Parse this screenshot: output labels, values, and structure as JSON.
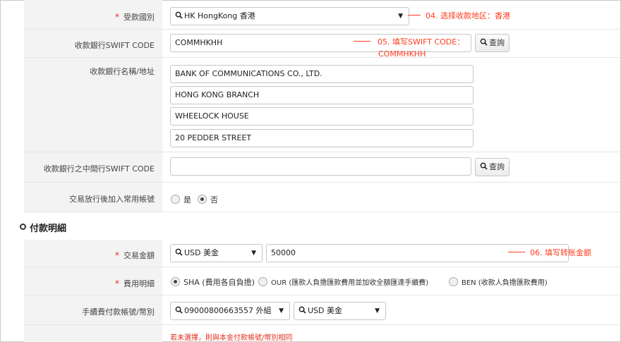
{
  "rows": {
    "country": {
      "label": "受款國別",
      "value": "HK HongKong 香港"
    },
    "swift": {
      "label": "收款銀行SWIFT CODE",
      "value": "COMMHKHH",
      "search_label": "查詢"
    },
    "bank_name": {
      "label": "收款銀行名稱/地址",
      "lines": [
        "BANK OF COMMUNICATIONS CO., LTD.",
        "HONG KONG BRANCH",
        "WHEELOCK HOUSE",
        "20 PEDDER STREET"
      ]
    },
    "intermediary": {
      "label": "收款銀行之中間行SWIFT CODE",
      "value": "",
      "search_label": "查詢"
    },
    "add_common": {
      "label": "交易放行後加入常用帳號",
      "options": [
        "是",
        "否"
      ],
      "selected": "否"
    }
  },
  "payment_section": {
    "title": "付款明細",
    "amount": {
      "label": "交易金額",
      "currency": "USD 美金",
      "value": "50000"
    },
    "fee": {
      "label": "費用明細",
      "options": [
        "SHA (費用各自負擔)",
        "OUR (匯款人負擔匯款費用並加收全額匯達手續費)",
        "BEN (收款人負擔匯款費用)"
      ],
      "selected": "SHA (費用各自負擔)"
    },
    "fee_account": {
      "label": "手續費付款帳號/幣別",
      "account": "09000800663557 外組",
      "currency": "USD 美金"
    },
    "hint": "若未選擇，則與本金付款帳號/幣別相同"
  },
  "annotations": {
    "a04": "04. 选择收款地区：香港",
    "a05_line1": "05. 填写SWIFT CODE：",
    "a05_line2": "COMMHKHH",
    "a06": "06. 填写转账金额"
  },
  "colors": {
    "annotation": "#ff3b1f",
    "required": "#e0301e",
    "label_bg": "#f3f3f3"
  }
}
